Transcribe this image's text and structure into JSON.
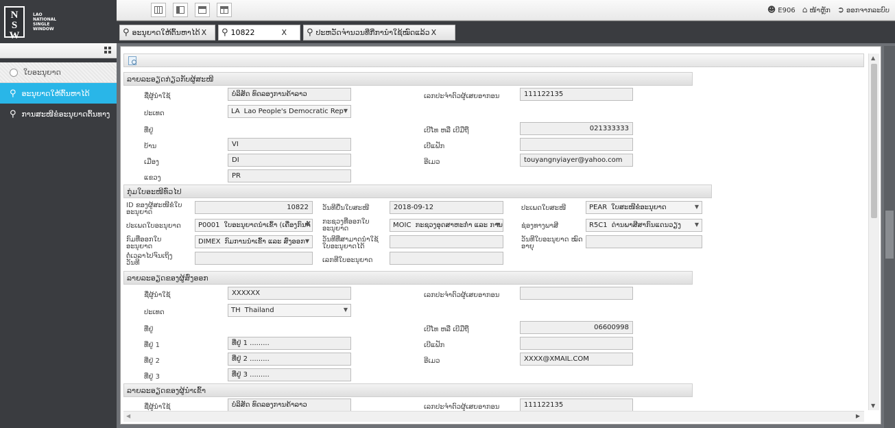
{
  "logo": {
    "text": "LAO\nNATIONAL\nSINGLE\nWINDOW"
  },
  "user": {
    "name": "E906",
    "home": "ໜ້າຫຼັກ",
    "logout": "ອອກຈາກລະບົບ"
  },
  "tabs": [
    {
      "label": "ອະນຸຍາດໃຫ້ຕົ້ນຫາໄດ້",
      "close": "X"
    },
    {
      "value": "10822",
      "close": "X"
    },
    {
      "label": "ປະຫວັດຈໍານວນທີ່ກີ່ການໍາໃຊ້ໝົດແລ້ວ",
      "close": "X"
    }
  ],
  "sidebar": {
    "items": [
      {
        "label": "ໃບອະນຸຍາດ"
      },
      {
        "label": "ອະນຸຍາດໃຫ້ຕົ້ນຫາໄດ້"
      },
      {
        "label": "ການສະໜີຂໍອະນຸຍາດຕົ້ນທາງ"
      }
    ]
  },
  "applicant": {
    "header": "ລາຍລະອຽດກ່ຽວກັບຜູ້ສະໜີ",
    "name_label": "ຊື່ຜູ້ນໍາໃຊ້",
    "name_value": "ບໍລິສັດ ທົດລອງການຄ້າລາວ",
    "tax_label": "ເລກປະຈໍາຕົວຜູ້ເສຍອາກອນ",
    "tax_value": "111122135",
    "country_label": "ປະເທດ",
    "country_code": "LA",
    "country_name": "Lao People's Democratic Rep",
    "address_label": "ທີ່ຢູ່",
    "phone_label": "ເບີໂທ ຫລື ເບີມືຖື",
    "phone_value": "021333333",
    "village_label": "ບ້ານ",
    "village_value": "VI",
    "fax_label": "ເບີແຟັກ",
    "fax_value": "",
    "district_label": "ເມືອງ",
    "district_value": "DI",
    "email_label": "ອີເມວ",
    "email_value": "touyangnyiayer@yahoo.com",
    "province_label": "ແຂວງ",
    "province_value": "PR"
  },
  "general": {
    "header": "ກຸ່ມໃບອະໜີທົ່ວໄປ",
    "id_label": "ID ຂອງຜູ້ສະໜີຂໍໃບ ອະນຸຍາດ",
    "id_value": "10822",
    "app_date_label": "ວັນທີຍື່ນໃບສະໜີ",
    "app_date_value": "2018-09-12",
    "app_type_label": "ປະເພດໃບສະໜີ",
    "app_type_code": "PEAR",
    "app_type_name": "ໃບສະໜີຂໍອະນຸຍາດ",
    "permit_type_label": "ປະເພດໃບອະນຸຍາດ",
    "permit_type_code": "P0001",
    "permit_type_name": "ໃບອະນຸຍາດນໍາເຂົ້າ (ເຄື່ອງກົນຈັ",
    "ministry_label": "ກະຊວງທີ່ອອກໃບ ອະນຸຍາດ",
    "ministry_code": "MOIC",
    "ministry_name": "ກະຊວງອຸດສາຫະກໍາ ແລະ ການຄ",
    "channel_label": "ຊ່ອງທາງພາສີ",
    "channel_code": "R5C1",
    "channel_name": "ດ່ານພາສີສາກົນແດນວຽງ",
    "dept_label": "ກົມທີ່ອອກໃບ ອະນຸຍາດ",
    "dept_code": "DIMEX",
    "dept_name": "ກົມການນໍາເຂົ້າ ແລະ ສົ່ງອອກ",
    "valid_label": "ວັນທີທີ່ສາມາດນໍາໃຊ້ ໃບອະນຸຍາດໄດ້",
    "valid_value": "",
    "expiry_label": "ວັນທີໃບອະນຸຍາດ ໝົດອາຍຸ",
    "expiry_value": "",
    "extend_label": "ຕໍ່ເວລາໄປຈົນເຖິງ ວັນທີ",
    "extend_value": "",
    "permit_no_label": "ເລກທີໃບອະນຸຍາດ",
    "permit_no_value": ""
  },
  "exporter": {
    "header": "ລາຍລະອຽດຂອງຜູ້ສົ່ງອອກ",
    "name_label": "ຊື່ຜູ້ນໍາໃຊ້",
    "name_value": "XXXXXX",
    "tax_label": "ເລກປະຈໍາຕົວຜູ້ເສຍອາກອນ",
    "tax_value": "",
    "country_label": "ປະເທດ",
    "country_code": "TH",
    "country_name": "Thailand",
    "address_label": "ທີ່ຢູ່",
    "phone_label": "ເບີໂທ ຫລື ເບີມືຖື",
    "phone_value": "06600998",
    "addr1_label": "ທີ່ຢູ່ 1",
    "addr1_value": "ທີ່ຢູ່ 1 .........",
    "fax_label": "ເບີແຟັກ",
    "fax_value": "",
    "addr2_label": "ທີ່ຢູ່ 2",
    "addr2_value": "ທີ່ຢູ່ 2 .........",
    "email_label": "ອີເມວ",
    "email_value": "XXXX@XMAIL.COM",
    "addr3_label": "ທີ່ຢູ່ 3",
    "addr3_value": "ທີ່ຢູ່ 3 ........."
  },
  "importer": {
    "header": "ລາຍລະອຽດຂອງຜູ້ນໍາເຂົ້າ",
    "name_label": "ຊື່ຜູ້ນໍາໃຊ້",
    "name_value": "ບໍລິສັດ ທົດລອງການຄ້າລາວ",
    "tax_label": "ເລກປະຈໍາຕົວຜູ້ເສຍອາກອນ",
    "tax_value": "111122135"
  },
  "colors": {
    "accent": "#29b6e8",
    "dark": "#3a3c40"
  }
}
